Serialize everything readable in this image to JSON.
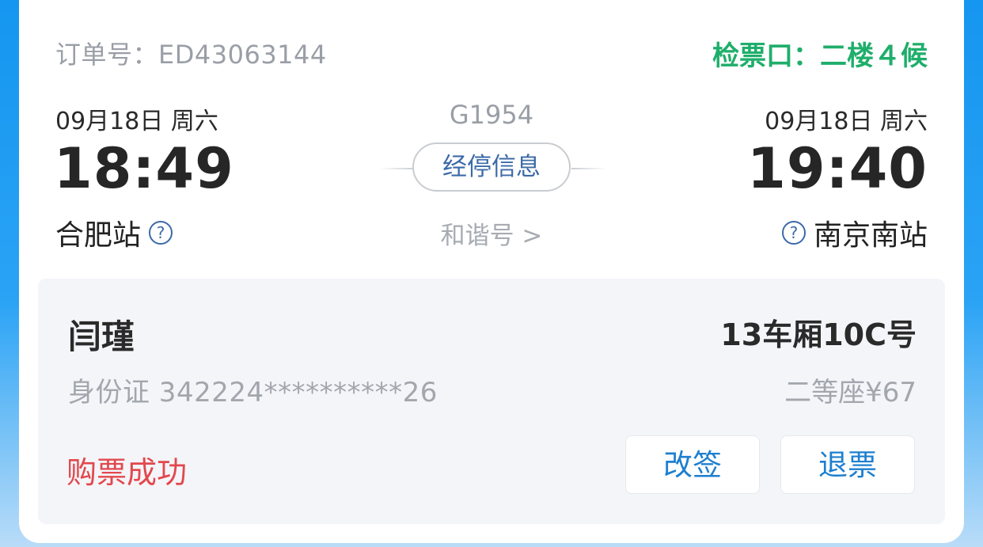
{
  "header": {
    "order_label": "订单号：",
    "order_no": "ED43063144",
    "gate": "检票口：二楼４候"
  },
  "departure": {
    "date": "09月18日  周六",
    "time": "18:49",
    "station": "合肥站"
  },
  "arrival": {
    "date": "09月18日  周六",
    "time": "19:40",
    "station": "南京南站"
  },
  "train": {
    "number": "G1954",
    "stops_button": "经停信息",
    "type_link": "和谐号 >"
  },
  "passenger": {
    "name": "闫瑾",
    "seat": "13车厢10C号",
    "id_card": "身份证 342224**********26",
    "fare": "二等座¥67",
    "status": "购票成功",
    "change_button": "改签",
    "refund_button": "退票"
  },
  "icons": {
    "help": "?"
  },
  "colors": {
    "gate": "#1fae6b",
    "status": "#e2484c",
    "action": "#1d7fcf",
    "help_icon": "#3c6aa7"
  }
}
